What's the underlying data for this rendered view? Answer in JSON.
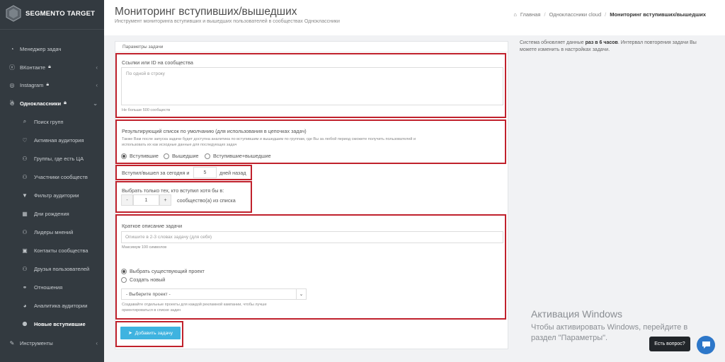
{
  "sidebar": {
    "logo_text": "SEGMENTO TARGET",
    "items": [
      {
        "label": "Менеджер задач",
        "icon": "tachometer-icon",
        "glyph": "◔"
      },
      {
        "label": "ВКонтакте",
        "icon": "vk-icon",
        "glyph": "ⓥ"
      },
      {
        "label": "Instagram",
        "icon": "instagram-icon",
        "glyph": "◎"
      },
      {
        "label": "Одноклассники",
        "icon": "odnoklassniki-icon",
        "glyph": "☃"
      },
      {
        "label": "Поиск групп",
        "icon": "search-icon",
        "glyph": "⌕"
      },
      {
        "label": "Активная аудитория",
        "icon": "thumbs-up-icon",
        "glyph": "♡"
      },
      {
        "label": "Группы, где есть ЦА",
        "icon": "users-icon",
        "glyph": "⚇"
      },
      {
        "label": "Участники сообществ",
        "icon": "group-icon",
        "glyph": "⚇"
      },
      {
        "label": "Фильтр аудитории",
        "icon": "filter-icon",
        "glyph": "▼"
      },
      {
        "label": "Дни рождения",
        "icon": "calendar-icon",
        "glyph": "▦"
      },
      {
        "label": "Лидеры мнений",
        "icon": "leaders-icon",
        "glyph": "⚇"
      },
      {
        "label": "Контакты сообщества",
        "icon": "contact-card-icon",
        "glyph": "▣"
      },
      {
        "label": "Друзья пользователей",
        "icon": "friends-icon",
        "glyph": "⚇"
      },
      {
        "label": "Отношения",
        "icon": "relations-icon",
        "glyph": "⚭"
      },
      {
        "label": "Аналитика аудитории",
        "icon": "chart-pie-icon",
        "glyph": "◕"
      },
      {
        "label": "Новые вступившие",
        "icon": "user-plus-icon",
        "glyph": "⚉"
      },
      {
        "label": "Инструменты",
        "icon": "wrench-icon",
        "glyph": "✎"
      }
    ]
  },
  "header": {
    "title": "Мониторинг вступивших/вышедших",
    "subtitle": "Инструмент мониторинга вступивших и вышедших пользователей в сообществах Одноклассники",
    "breadcrumbs": [
      "Главная",
      "Одноклассники cloud",
      "Мониторинг вступивших/вышедших"
    ]
  },
  "form": {
    "panel_title": "Параметры задачи",
    "links_label": "Ссылки или ID на сообщества",
    "links_placeholder": "По одной в строку",
    "links_hint": "Не больше 500 сообществ",
    "result_label": "Результирующий список по умолчанию (для использования в цепочках задач)",
    "result_hint": "Также Вам после запуска задачи будет доступна аналитика по вступившим и вышедшим по группам, где Вы за любой период сможете получить пользователей и использовать их как исходные данные для последующих задач",
    "radio_joined": "Вступившие",
    "radio_left": "Вышедшие",
    "radio_both": "Вступившие+вышедшие",
    "days_prefix": "Вступил/вышел за сегодня и",
    "days_value": "5",
    "days_suffix": "дней назад",
    "choose_label": "Выбрать только тех, кто вступил хотя бы в:",
    "minus": "-",
    "count_value": "1",
    "plus": "+",
    "count_suffix": "сообщество(а) из списка",
    "desc_label": "Краткое описание задачи",
    "desc_placeholder": "Опишите в 2-3 словах задачу (для себя)",
    "desc_hint": "Максимум 100 символов",
    "project_existing": "Выбрать существующий проект",
    "project_new": "Создать новый",
    "project_select": "- Выберите проект -",
    "project_hint": "Создавайте отдельные проекты для каждой рекламной кампании, чтобы лучше ориентироваться в списке задач",
    "add_button": "Добавить задачу"
  },
  "info": {
    "text_before": "Система обновляет данные ",
    "text_bold": "раз в 6 часов",
    "text_after": ". Интервал повторения задачи Вы можете изменить в настройках задачи."
  },
  "overlay": {
    "windows_title": "Активация Windows",
    "windows_text": "Чтобы активировать Windows, перейдите в раздел \"Параметры\".",
    "help_label": "Есть вопрос?"
  },
  "colors": {
    "sidebar_bg": "#333a40",
    "accent": "#3fb3e0",
    "highlight_red": "#c0212c"
  }
}
